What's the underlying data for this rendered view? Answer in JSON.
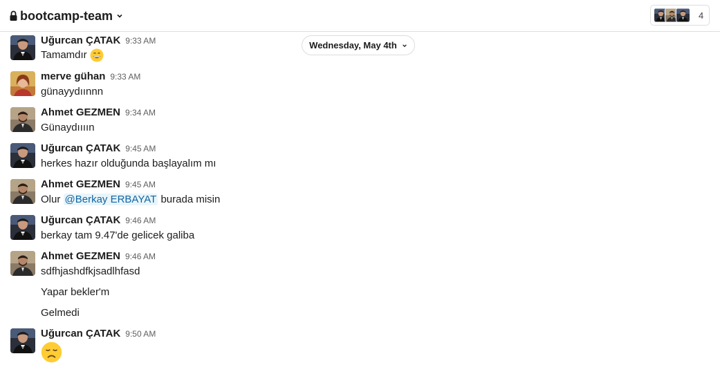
{
  "header": {
    "channel_name": "bootcamp-team",
    "member_count": "4"
  },
  "date_divider": "Wednesday, May 4th",
  "messages": [
    {
      "sender": "Uğurcan ÇATAK",
      "time": "9:33 AM",
      "text": "Tamamdır",
      "emoji": "grinning-smile"
    },
    {
      "sender": "merve gühan",
      "time": "9:33 AM",
      "text": "günayydıınnn"
    },
    {
      "sender": "Ahmet GEZMEN",
      "time": "9:34 AM",
      "text": "Günaydıııın"
    },
    {
      "sender": "Uğurcan ÇATAK",
      "time": "9:45 AM",
      "text": "herkes hazır olduğunda başlayalım mı"
    },
    {
      "sender": "Ahmet GEZMEN",
      "time": "9:45 AM",
      "text_before": "Olur",
      "mention": "@Berkay ERBAYAT",
      "text_after": "burada misin"
    },
    {
      "sender": "Uğurcan ÇATAK",
      "time": "9:46 AM",
      "text": "berkay tam 9.47'de gelicek galiba"
    },
    {
      "sender": "Ahmet GEZMEN",
      "time": "9:46 AM",
      "text": "sdfhjashdfkjsadlhfasd",
      "followups": [
        "Yapar bekler'm",
        "Gelmedi"
      ]
    },
    {
      "sender": "Uğurcan ÇATAK",
      "time": "9:50 AM",
      "emoji": "disappointed-face"
    }
  ]
}
